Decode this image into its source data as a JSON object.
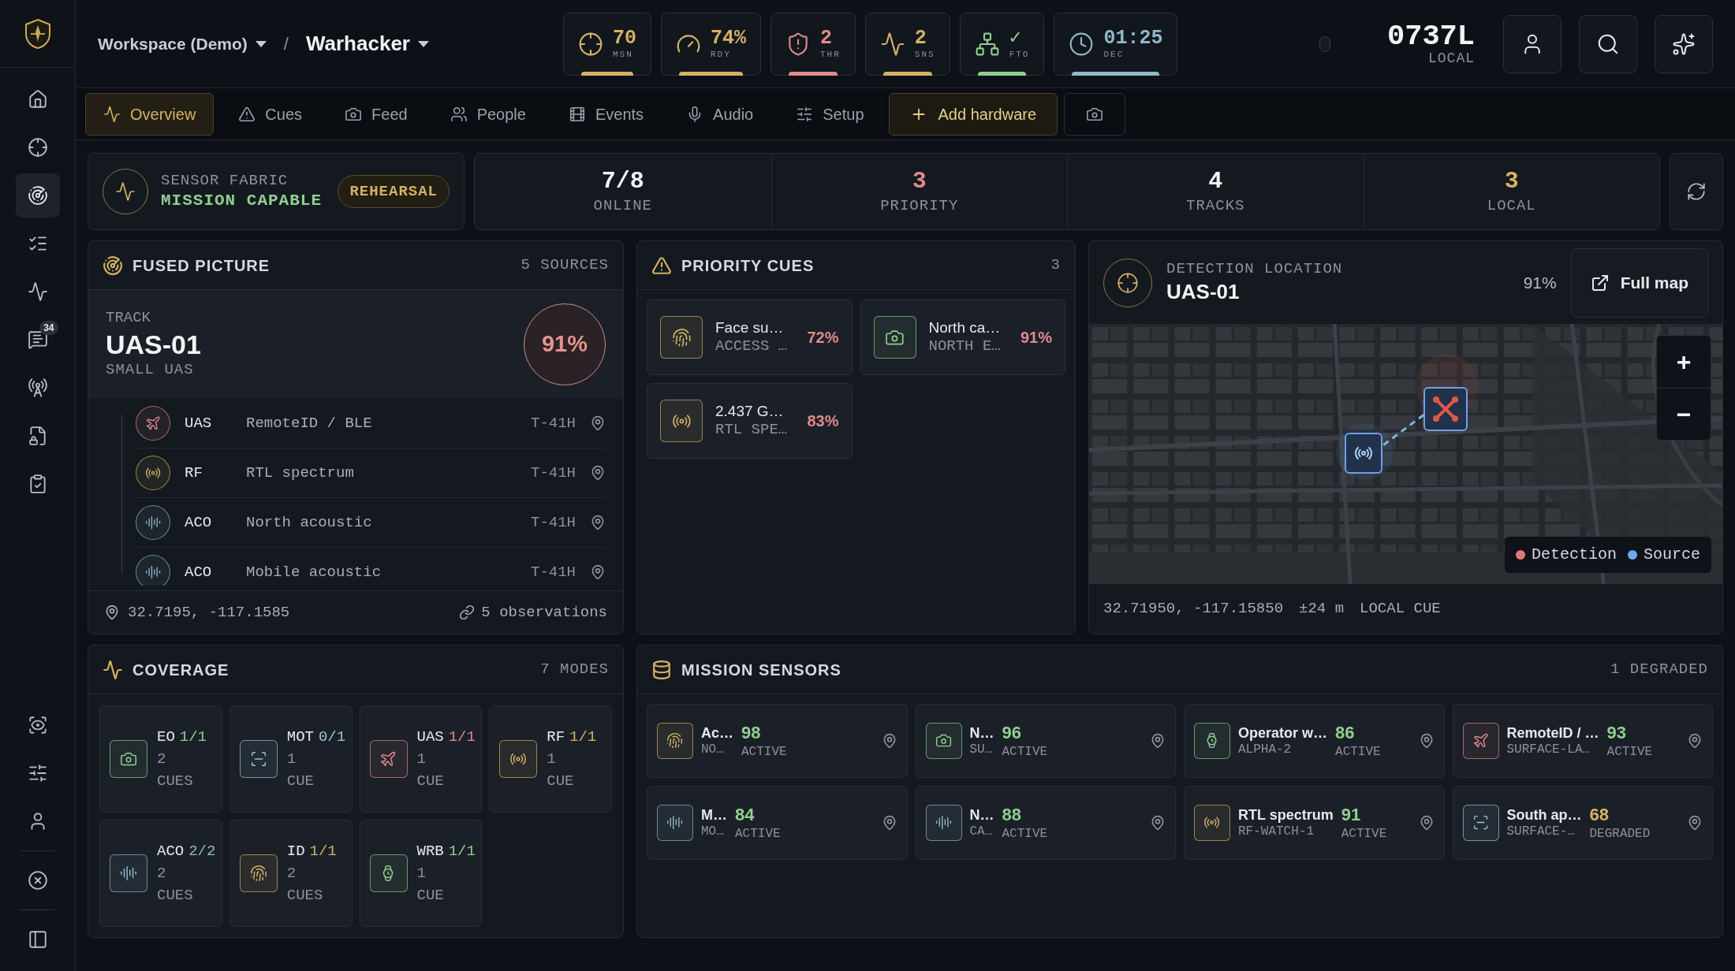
{
  "sidebar": {
    "top": [
      {
        "kind": "home",
        "selected": false
      },
      {
        "kind": "target",
        "selected": false
      },
      {
        "kind": "radar",
        "selected": true
      },
      {
        "kind": "list",
        "selected": false
      },
      {
        "kind": "activity",
        "selected": false
      },
      {
        "kind": "messages",
        "selected": false,
        "badge": "34"
      },
      {
        "kind": "antenna",
        "selected": false
      },
      {
        "kind": "file",
        "selected": false
      },
      {
        "kind": "clipboard",
        "selected": false
      }
    ],
    "bottom": [
      {
        "kind": "scan",
        "selected": false
      },
      {
        "kind": "sliders",
        "selected": false
      },
      {
        "kind": "user",
        "selected": false
      },
      {
        "kind": "close",
        "selected": false
      },
      {
        "kind": "panel",
        "selected": false
      }
    ]
  },
  "breadcrumb": {
    "workspace": "Workspace (Demo)",
    "separator": "/",
    "project": "Warhacker"
  },
  "metrics": [
    {
      "kind": "target",
      "value": "70",
      "label": "MSN",
      "color": "#d4b264"
    },
    {
      "kind": "gauge",
      "value": "74%",
      "label": "RDY",
      "color": "#d4b264"
    },
    {
      "kind": "shield",
      "value": "2",
      "label": "THR",
      "color": "#e08a8a"
    },
    {
      "kind": "activity",
      "value": "2",
      "label": "SNS",
      "color": "#d4b264"
    },
    {
      "kind": "network",
      "value": "✓",
      "label": "FTO",
      "color": "#8fcf8f"
    },
    {
      "kind": "clock",
      "value": "01:25",
      "label": "DEC",
      "color": "#8fb8c8"
    }
  ],
  "clock": {
    "time": "0737L",
    "zone": "LOCAL"
  },
  "tabs": [
    {
      "kind": "activity",
      "label": "Overview",
      "selected": true
    },
    {
      "kind": "alert",
      "label": "Cues",
      "selected": false
    },
    {
      "kind": "camera",
      "label": "Feed",
      "selected": false
    },
    {
      "kind": "people",
      "label": "People",
      "selected": false
    },
    {
      "kind": "film",
      "label": "Events",
      "selected": false
    },
    {
      "kind": "mic",
      "label": "Audio",
      "selected": false
    },
    {
      "kind": "sliders",
      "label": "Setup",
      "selected": false
    }
  ],
  "add_hardware": "Add hardware",
  "fabric": {
    "label": "SENSOR FABRIC",
    "status": "MISSION CAPABLE",
    "badge": "REHEARSAL"
  },
  "stats": [
    {
      "value": "7/8",
      "label": "ONLINE",
      "color": "#f1f3f5"
    },
    {
      "value": "3",
      "label": "PRIORITY",
      "color": "#e08a8a"
    },
    {
      "value": "4",
      "label": "TRACKS",
      "color": "#f1f3f5"
    },
    {
      "value": "3",
      "label": "LOCAL",
      "color": "#d4b264"
    }
  ],
  "fused": {
    "title": "FUSED PICTURE",
    "count": "5 SOURCES",
    "track": {
      "label": "TRACK",
      "name": "UAS-01",
      "type": "SMALL UAS",
      "confidence": "91%"
    },
    "sources": [
      {
        "kind": "uas",
        "code": "UAS",
        "name": "RemoteID / BLE",
        "time": "T-41H"
      },
      {
        "kind": "rf",
        "code": "RF",
        "name": "RTL spectrum",
        "time": "T-41H"
      },
      {
        "kind": "aco",
        "code": "ACO",
        "name": "North acoustic",
        "time": "T-41H"
      },
      {
        "kind": "aco",
        "code": "ACO",
        "name": "Mobile acoustic",
        "time": "T-41H"
      }
    ],
    "location": "32.7195, -117.1585",
    "observations": "5 observations"
  },
  "priority": {
    "title": "PRIORITY CUES",
    "count": "3",
    "cues": [
      {
        "kind": "id",
        "title": "Face su…",
        "subtitle": "ACCESS …",
        "score": "72%"
      },
      {
        "kind": "eo",
        "title": "North ca…",
        "subtitle": "NORTH E…",
        "score": "91%"
      },
      {
        "kind": "rf",
        "title": "2.437 G…",
        "subtitle": "RTL SPE…",
        "score": "83%"
      }
    ]
  },
  "detection": {
    "label": "DETECTION LOCATION",
    "track": "UAS-01",
    "confidence": "91%",
    "button": "Full map",
    "zoom": [
      "+",
      "−"
    ],
    "legend": [
      {
        "label": "Detection",
        "color": "#e07878"
      },
      {
        "label": "Source",
        "color": "#6fa8f0"
      }
    ],
    "footer": [
      "32.71950, -117.15850",
      "±24 m",
      "LOCAL CUE"
    ]
  },
  "coverage": {
    "title": "COVERAGE",
    "count": "7 MODES",
    "modes": [
      {
        "kind": "eo",
        "code": "EO",
        "ratio": "1/1",
        "count": "2",
        "unit": "CUES"
      },
      {
        "kind": "mot",
        "code": "MOT",
        "ratio": "0/1",
        "count": "1",
        "unit": "CUE"
      },
      {
        "kind": "uas",
        "code": "UAS",
        "ratio": "1/1",
        "count": "1",
        "unit": "CUE"
      },
      {
        "kind": "rf",
        "code": "RF",
        "ratio": "1/1",
        "count": "1",
        "unit": "CUE"
      },
      {
        "kind": "aco",
        "code": "ACO",
        "ratio": "2/2",
        "count": "2",
        "unit": "CUES"
      },
      {
        "kind": "id",
        "code": "ID",
        "ratio": "1/1",
        "count": "2",
        "unit": "CUES"
      },
      {
        "kind": "wrb",
        "code": "WRB",
        "ratio": "1/1",
        "count": "1",
        "unit": "CUE"
      }
    ]
  },
  "sensors": {
    "title": "MISSION SENSORS",
    "count": "1 DEGRADED",
    "items": [
      {
        "kind": "id",
        "name": "Ac…",
        "sub": "NO…",
        "score": "98",
        "status": "ACTIVE",
        "degraded": false
      },
      {
        "kind": "eo",
        "name": "N…",
        "sub": "SU…",
        "score": "96",
        "status": "ACTIVE",
        "degraded": false
      },
      {
        "kind": "wrb",
        "name": "Operator w…",
        "sub": "ALPHA-2",
        "score": "86",
        "status": "ACTIVE",
        "degraded": false
      },
      {
        "kind": "uas",
        "name": "RemoteID / …",
        "sub": "SURFACE-LA…",
        "score": "93",
        "status": "ACTIVE",
        "degraded": false
      },
      {
        "kind": "aco",
        "name": "M…",
        "sub": "MO…",
        "score": "84",
        "status": "ACTIVE",
        "degraded": false
      },
      {
        "kind": "aco",
        "name": "N…",
        "sub": "CA…",
        "score": "88",
        "status": "ACTIVE",
        "degraded": false
      },
      {
        "kind": "rf",
        "name": "RTL spectrum",
        "sub": "RF-WATCH-1",
        "score": "91",
        "status": "ACTIVE",
        "degraded": false
      },
      {
        "kind": "mot",
        "name": "South ap…",
        "sub": "SURFACE-…",
        "score": "68",
        "status": "DEGRADED",
        "degraded": true
      }
    ]
  }
}
